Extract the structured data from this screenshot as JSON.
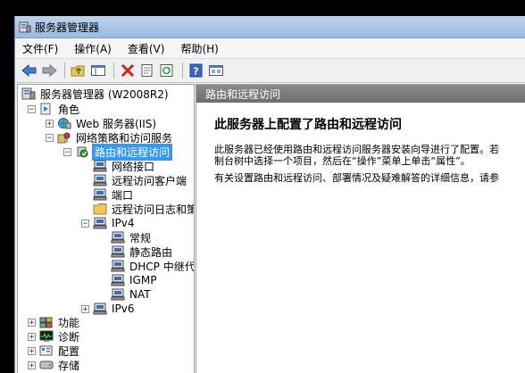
{
  "window": {
    "title": "服务器管理器"
  },
  "menu": {
    "file": "文件(F)",
    "action": "操作(A)",
    "view": "查看(V)",
    "help": "帮助(H)"
  },
  "toolbar": {
    "icons": [
      "back-icon",
      "forward-icon",
      "up-folder-icon",
      "show-hide-tree-icon",
      "delete-icon",
      "properties-icon",
      "refresh-icon",
      "help-icon",
      "console-icon"
    ]
  },
  "tree": {
    "root": "服务器管理器 (W2008R2)",
    "roles": "角色",
    "web": "Web 服务器(IIS)",
    "npas": "网络策略和访问服务",
    "rras": "路由和远程访问",
    "net_if": "网络接口",
    "ra_clients": "远程访问客户端",
    "ports": "端口",
    "ra_logging": "远程访问日志和策",
    "ipv4": "IPv4",
    "general": "常规",
    "static_routes": "静态路由",
    "dhcp_relay": "DHCP 中继代理",
    "igmp": "IGMP",
    "nat": "NAT",
    "ipv6": "IPv6",
    "features": "功能",
    "diagnostics": "诊断",
    "config": "配置",
    "storage": "存储"
  },
  "content": {
    "header": "路由和远程访问",
    "title": "此服务器上配置了路由和远程访问",
    "para1_line1": "此服务器已经使用路由和远程访问服务器安装向导进行了配置。若",
    "para1_line2": "制台树中选择一个项目，然后在“操作”菜单上单击“属性”。",
    "para2": "有关设置路由和远程访问、部署情况及疑难解答的详细信息，请参"
  }
}
